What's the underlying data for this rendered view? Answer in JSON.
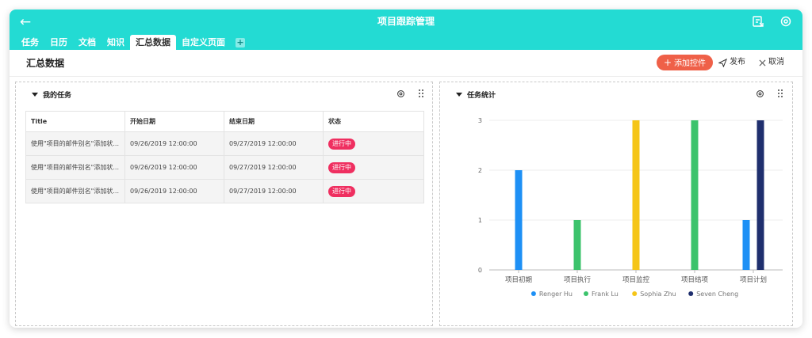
{
  "header": {
    "title": "项目跟踪管理",
    "back_icon": "arrow-left-icon",
    "right_icons": [
      "share-icon",
      "settings-icon"
    ]
  },
  "tabs": [
    {
      "label": "任务"
    },
    {
      "label": "日历"
    },
    {
      "label": "文档"
    },
    {
      "label": "知识"
    },
    {
      "label": "汇总数据",
      "active": true
    },
    {
      "label": "自定义页面"
    }
  ],
  "toolbar": {
    "page_title": "汇总数据",
    "add_widget_label": "添加控件",
    "publish_label": "发布",
    "cancel_label": "取消"
  },
  "my_tasks": {
    "title": "我的任务",
    "columns": [
      "Title",
      "开始日期",
      "结束日期",
      "状态"
    ],
    "rows": [
      {
        "title": "使用\"项目的邮件别名\"添加状...",
        "start": "09/26/2019 12:00:00",
        "end": "09/27/2019 12:00:00",
        "status": "进行中"
      },
      {
        "title": "使用\"项目的邮件别名\"添加状...",
        "start": "09/26/2019 12:00:00",
        "end": "09/27/2019 12:00:00",
        "status": "进行中"
      },
      {
        "title": "使用\"项目的邮件别名\"添加状...",
        "start": "09/26/2019 12:00:00",
        "end": "09/27/2019 12:00:00",
        "status": "进行中"
      }
    ]
  },
  "task_stats": {
    "title": "任务统计"
  },
  "colors": {
    "accent": "#23dbd3",
    "add_button": "#ef6048",
    "status_badge": "#ef2f60"
  },
  "chart_data": {
    "type": "bar",
    "categories": [
      "项目初期",
      "项目执行",
      "项目监控",
      "项目结项",
      "项目计划"
    ],
    "series": [
      {
        "name": "Renger Hu",
        "color": "#1e90f5",
        "values": [
          2,
          0,
          0,
          0,
          1
        ]
      },
      {
        "name": "Frank Lu",
        "color": "#3cc36c",
        "values": [
          0,
          1,
          0,
          3,
          0
        ]
      },
      {
        "name": "Sophia Zhu",
        "color": "#f5c518",
        "values": [
          0,
          0,
          3,
          0,
          0
        ]
      },
      {
        "name": "Seven Cheng",
        "color": "#1f2f6e",
        "values": [
          0,
          0,
          0,
          0,
          3
        ]
      }
    ],
    "yticks": [
      0,
      1,
      2,
      3
    ],
    "ylim": [
      0,
      3
    ],
    "grid": true,
    "legend": "bottom"
  }
}
